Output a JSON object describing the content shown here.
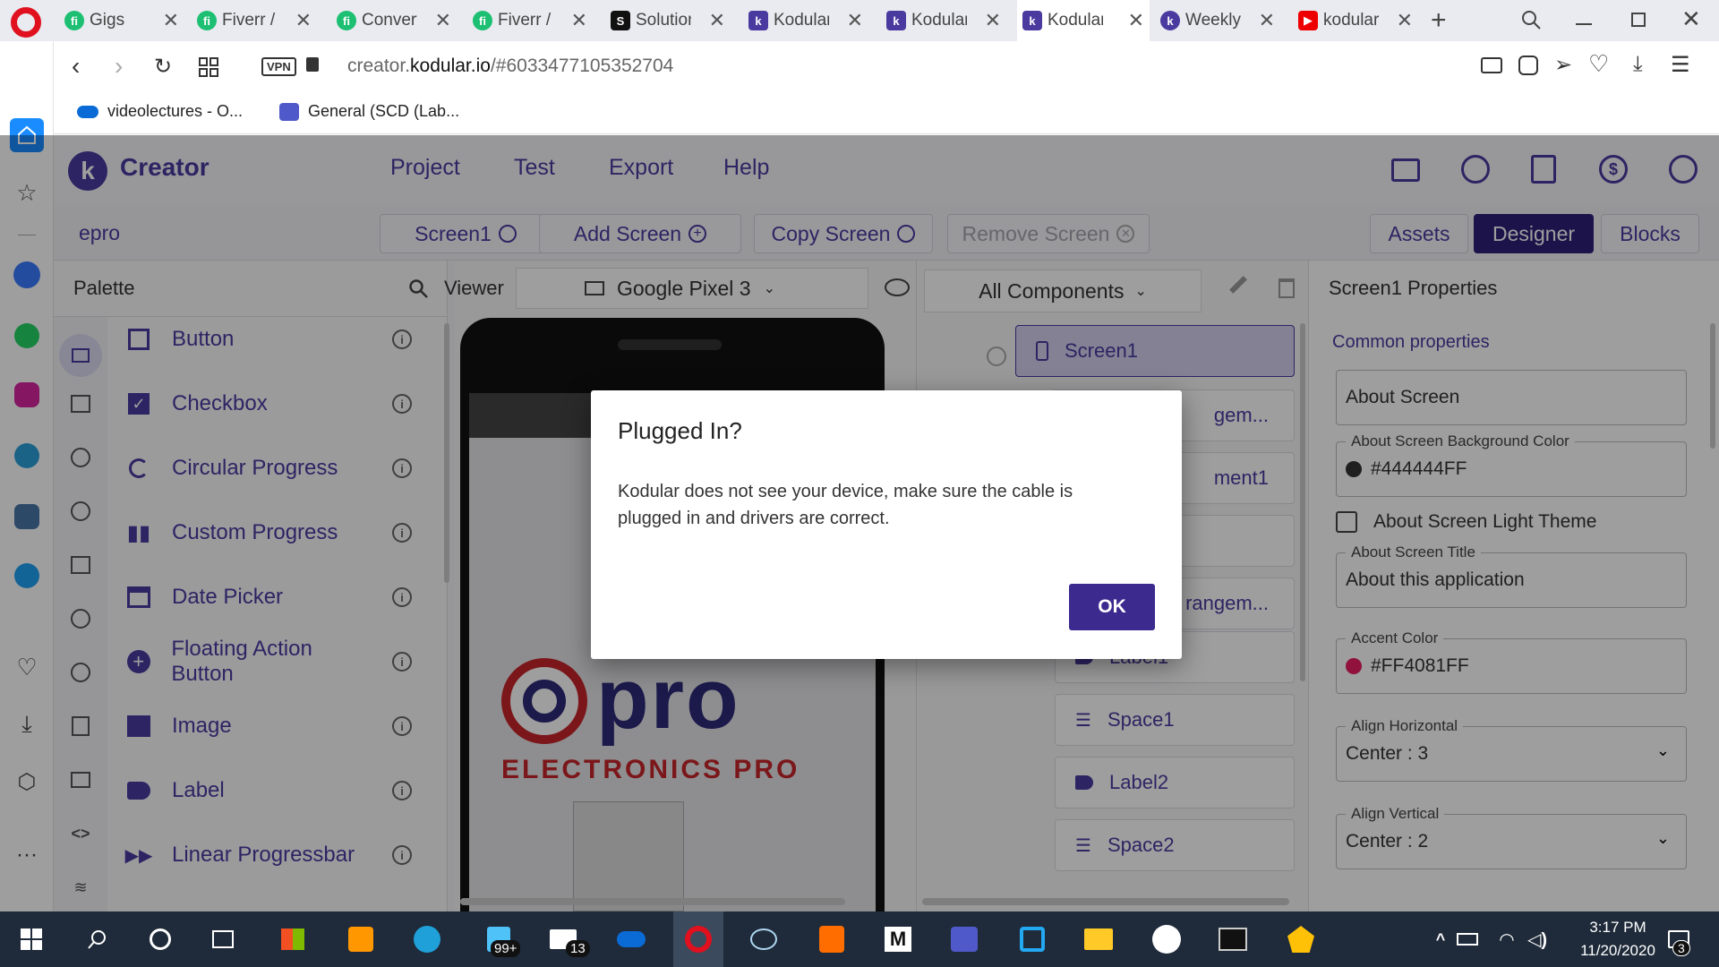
{
  "browser": {
    "tabs": [
      {
        "title": "Gigs",
        "icon": "fiverr-icon"
      },
      {
        "title": "Fiverr / S",
        "icon": "fiverr-icon"
      },
      {
        "title": "Convert",
        "icon": "fiverr-icon"
      },
      {
        "title": "Fiverr / a",
        "icon": "fiverr-icon"
      },
      {
        "title": "Solution",
        "icon": "solutions-icon"
      },
      {
        "title": "Kodular C",
        "icon": "kodular-icon"
      },
      {
        "title": "Kodular S",
        "icon": "kodular-icon"
      },
      {
        "title": "Kodular C",
        "icon": "kodular-icon"
      },
      {
        "title": "Weekly t",
        "icon": "kodular-icon"
      },
      {
        "title": "kodular l",
        "icon": "youtube-icon"
      }
    ],
    "url_prefix": "creator.",
    "url_domain": "kodular.io",
    "url_path": "/#6033477105352704",
    "vpn_label": "VPN",
    "bookmarks": [
      "videolectures - O...",
      "General (SCD (Lab..."
    ]
  },
  "app": {
    "brand": "Creator",
    "menu": [
      "Project",
      "Test",
      "Export",
      "Help"
    ],
    "project_name": "epro",
    "screen_select": "Screen1",
    "add_screen": "Add Screen",
    "copy_screen": "Copy Screen",
    "remove_screen": "Remove Screen",
    "view_tabs": [
      "Assets",
      "Designer",
      "Blocks"
    ],
    "palette_title": "Palette",
    "palette_items": [
      "Button",
      "Checkbox",
      "Circular Progress",
      "Custom Progress",
      "Date Picker",
      "Floating Action Button",
      "Image",
      "Label",
      "Linear Progressbar"
    ],
    "viewer_title": "Viewer",
    "device": "Google Pixel 3",
    "components_filter": "All Components",
    "components": [
      "Screen1",
      "gem...",
      "ment1",
      "",
      "rangem...",
      "Label1",
      "Space1",
      "Label2",
      "Space2"
    ],
    "logo_text": "ELECTRONICS PRO",
    "logo_word": "pro",
    "properties_title": "Screen1 Properties",
    "common_properties": "Common properties",
    "props": {
      "about_screen": "About Screen",
      "bg_color_label": "About Screen Background Color",
      "bg_color_value": "#444444FF",
      "light_theme": "About Screen Light Theme",
      "title_label": "About Screen Title",
      "title_value": "About this application",
      "accent_label": "Accent Color",
      "accent_value": "#FF4081FF",
      "align_h_label": "Align Horizontal",
      "align_h_value": "Center : 3",
      "align_v_label": "Align Vertical",
      "align_v_value": "Center : 2"
    }
  },
  "dialog": {
    "title": "Plugged In?",
    "message": "Kodular does not see your device, make sure the cable is plugged in and drivers are correct.",
    "ok": "OK"
  },
  "taskbar": {
    "time": "3:17 PM",
    "date": "11/20/2020",
    "explorer_badge": "99+",
    "mail_badge": "13",
    "notif_badge": "3"
  },
  "colors": {
    "accent": "#4a3aa0",
    "designer_active": "#2e1f7a",
    "ok_button": "#3d2a8f",
    "accent_dot": "#e91e63",
    "bg_dot": "#333333"
  }
}
